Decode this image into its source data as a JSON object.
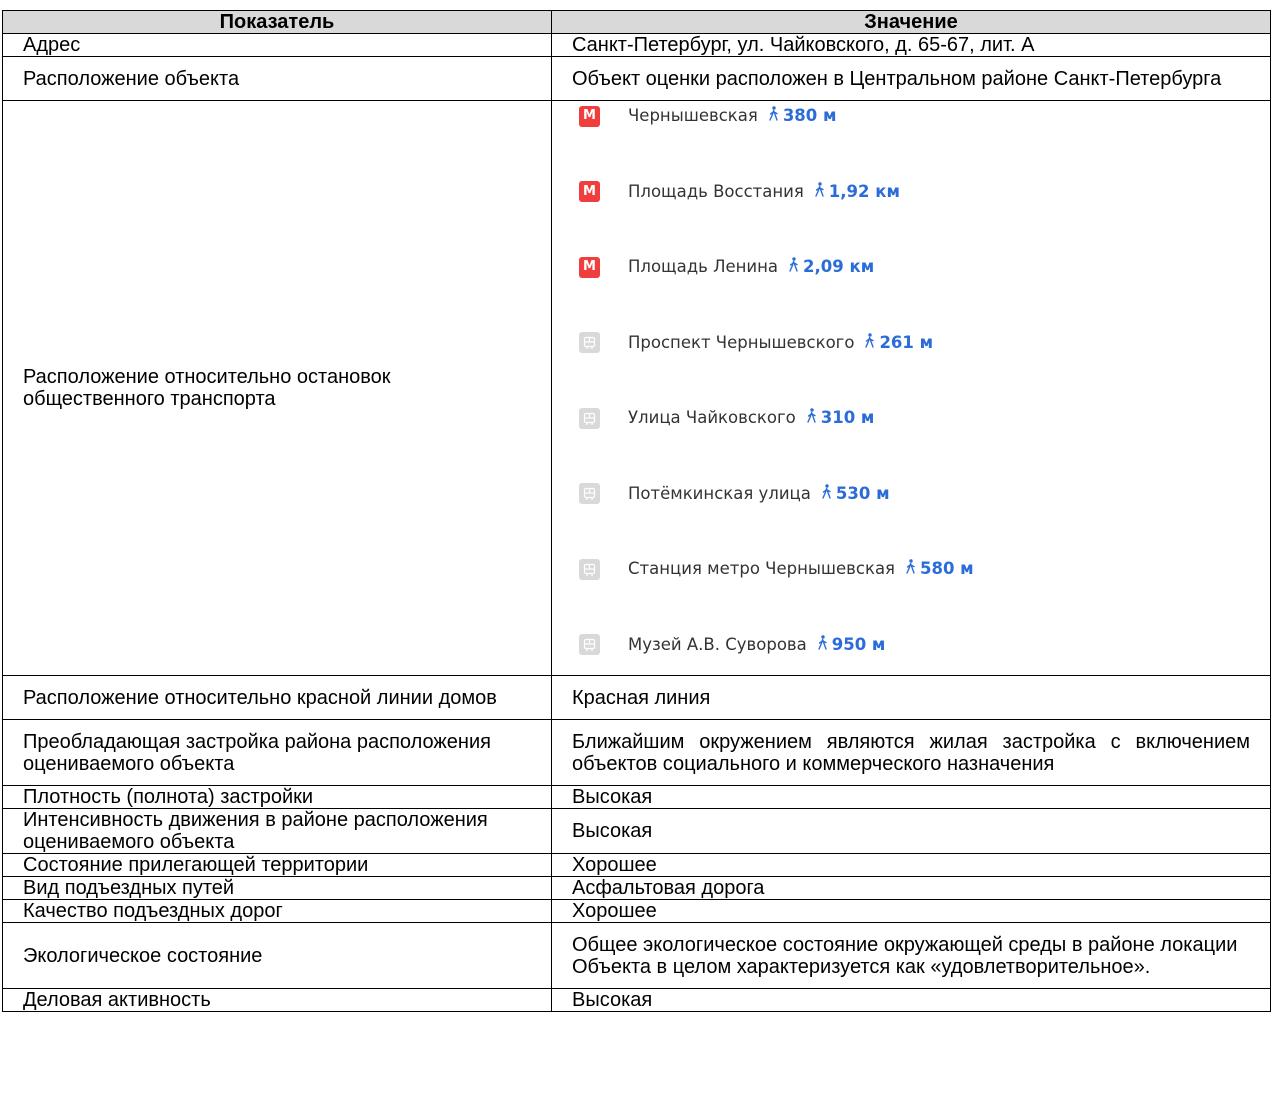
{
  "header": {
    "col1": "Показатель",
    "col2": "Значение"
  },
  "rows": [
    {
      "label": "Адрес",
      "value": "Санкт-Петербург, ул. Чайковского, д. 65-67, лит. А"
    },
    {
      "label": "Расположение объекта",
      "value": "Объект оценки расположен в Центральном районе Санкт-Петербурга"
    },
    {
      "label": "Расположение относительно остановок общественного транспорта"
    },
    {
      "label": "Расположение относительно красной линии домов",
      "value": "Красная линия"
    },
    {
      "label": "Преобладающая застройка района расположения оцениваемого объекта",
      "value": "Ближайшим окружением являются жилая застройка с включением объектов социального и коммерческого назначения"
    },
    {
      "label": "Плотность (полнота) застройки",
      "value": "Высокая"
    },
    {
      "label": "Интенсивность движения в районе расположения оцениваемого объекта",
      "value": "Высокая"
    },
    {
      "label": "Состояние прилегающей территории",
      "value": "Хорошее"
    },
    {
      "label": "Вид подъездных путей",
      "value": "Асфальтовая дорога"
    },
    {
      "label": "Качество подъездных дорог",
      "value": "Хорошее"
    },
    {
      "label": "Экологическое состояние",
      "value": "Общее экологическое состояние окружающей среды в районе локации Объекта в целом характеризуется как «удовлетворительное»."
    },
    {
      "label": "Деловая активность",
      "value": "Высокая"
    }
  ],
  "stops": [
    {
      "type": "metro",
      "icon": "metro-icon",
      "icon_text": "М",
      "name": "Чернышевская",
      "distance": "380 м"
    },
    {
      "type": "metro",
      "icon": "metro-icon",
      "icon_text": "М",
      "name": "Площадь Восстания",
      "distance": "1,92 км"
    },
    {
      "type": "metro",
      "icon": "metro-icon",
      "icon_text": "М",
      "name": "Площадь Ленина",
      "distance": "2,09 км"
    },
    {
      "type": "bus",
      "icon": "bus-icon",
      "name": "Проспект Чернышевского",
      "distance": "261 м"
    },
    {
      "type": "bus",
      "icon": "bus-icon",
      "name": "Улица Чайковского",
      "distance": "310 м"
    },
    {
      "type": "bus",
      "icon": "bus-icon",
      "name": "Потёмкинская улица",
      "distance": "530 м"
    },
    {
      "type": "bus",
      "icon": "bus-icon",
      "name": "Станция метро Чернышевская",
      "distance": "580 м"
    },
    {
      "type": "bus",
      "icon": "bus-icon",
      "name": "Музей А.В. Суворова",
      "distance": "950 м"
    }
  ],
  "colors": {
    "metro": "#f03d3d",
    "bus": "#d9d9d9",
    "distance": "#2b6cd9",
    "header_bg": "#d9d9d9"
  }
}
